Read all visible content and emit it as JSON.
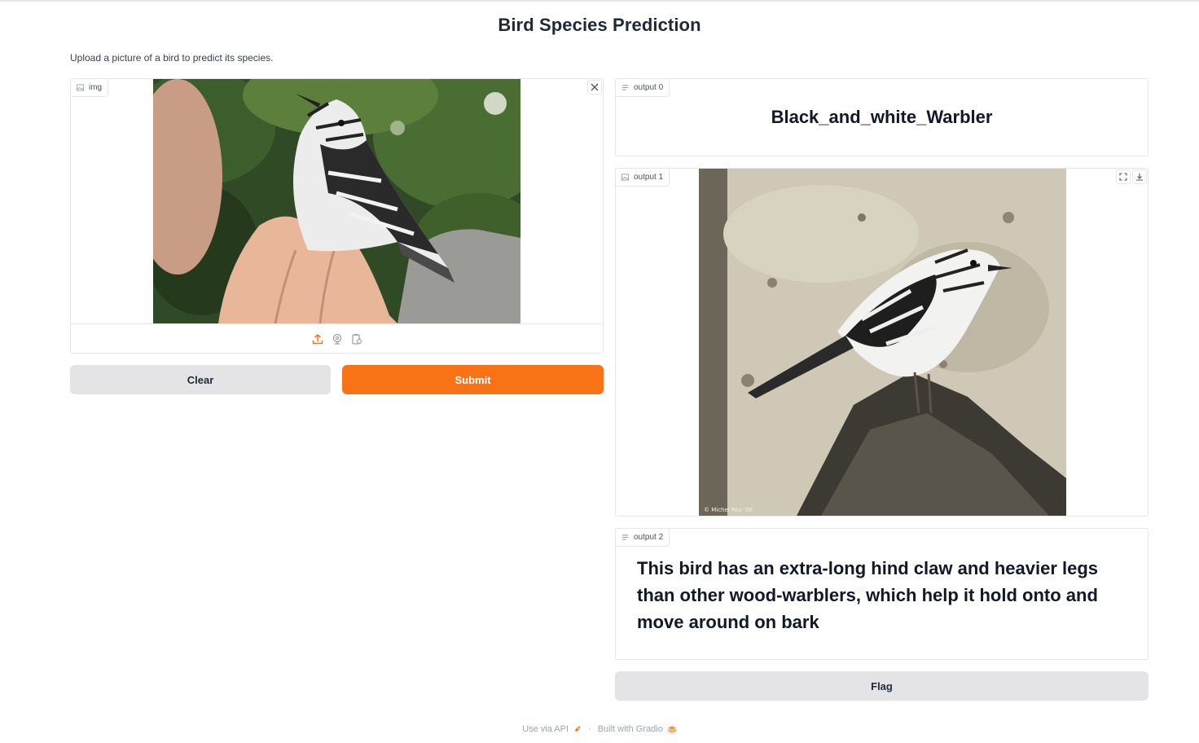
{
  "page": {
    "title": "Bird Species Prediction",
    "description": "Upload a picture of a bird to predict its species."
  },
  "input": {
    "label": "img",
    "source_icons": [
      "upload-icon",
      "webcam-icon",
      "clipboard-icon"
    ],
    "clear_icon": "close-icon"
  },
  "buttons": {
    "clear": "Clear",
    "submit": "Submit",
    "flag": "Flag"
  },
  "outputs": {
    "output0": {
      "label": "output 0",
      "value": "Black_and_white_Warbler"
    },
    "output1": {
      "label": "output 1",
      "photo_credit": "© Michel Roy '08"
    },
    "output2": {
      "label": "output 2",
      "value": "This bird has an extra-long hind claw and heavier legs than other wood-warblers, which help it hold onto and move around on bark"
    }
  },
  "footer": {
    "api": "Use via API",
    "separator": "·",
    "built": "Built with Gradio"
  },
  "colors": {
    "primary": "#f97316",
    "secondary": "#e4e4e7"
  }
}
